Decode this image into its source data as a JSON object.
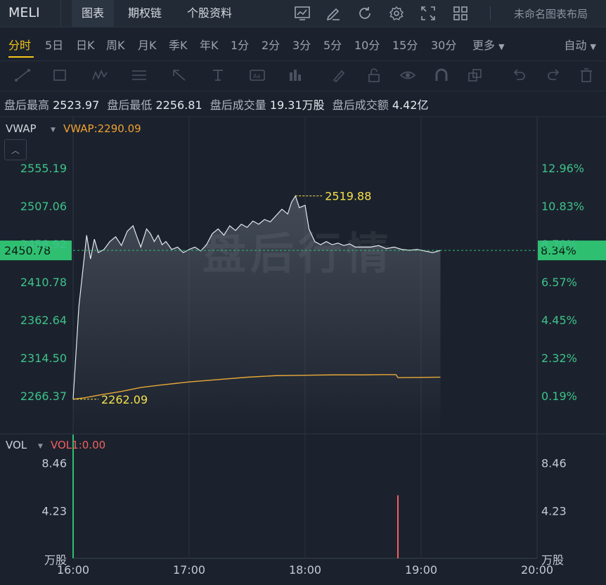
{
  "header": {
    "symbol": "MELI",
    "tabs": [
      "图表",
      "期权链",
      "个股资料"
    ],
    "layout_name": "未命名图表布局"
  },
  "periods": {
    "items": [
      "分时",
      "5日",
      "日K",
      "周K",
      "月K",
      "季K",
      "年K",
      "1分",
      "2分",
      "3分",
      "5分",
      "10分",
      "15分",
      "30分",
      "更多"
    ],
    "active": "分时",
    "auto": "自动"
  },
  "stats": {
    "high_label": "盘后最高",
    "high": "2523.97",
    "low_label": "盘后最低",
    "low": "2256.81",
    "volume_label": "盘后成交量",
    "volume": "19.31万股",
    "turnover_label": "盘后成交额",
    "turnover": "4.42亿"
  },
  "watermark": "盘后行情",
  "chart_data": {
    "type": "line",
    "price_panel": {
      "indicator_label": "VWAP",
      "indicator_value": "VWAP:2290.09",
      "y_ticks_left": [
        "2555.19",
        "2507.06",
        "2458.92",
        "2410.78",
        "2362.64",
        "2314.50",
        "2266.37"
      ],
      "y_ticks_right": [
        "12.96%",
        "10.83%",
        "8.70%",
        "6.57%",
        "4.45%",
        "2.32%",
        "0.19%"
      ],
      "ylim": [
        2266.37,
        2555.19
      ],
      "last_price": "2450.78",
      "last_change": "8.34%",
      "annotations": {
        "high": "2519.88",
        "low": "2262.09"
      },
      "x_ticks": [
        "16:00",
        "17:00",
        "18:00",
        "19:00",
        "20:00"
      ],
      "xlim_minutes": [
        0,
        240
      ],
      "series": [
        {
          "name": "",
          "color": "#e6e9ee",
          "points": [
            [
              0,
              2262.09
            ],
            [
              3,
              2380
            ],
            [
              7,
              2470
            ],
            [
              9,
              2440
            ],
            [
              11,
              2465
            ],
            [
              13,
              2448
            ],
            [
              16,
              2452
            ],
            [
              19,
              2462
            ],
            [
              22,
              2468
            ],
            [
              25,
              2457
            ],
            [
              28,
              2475
            ],
            [
              31,
              2482
            ],
            [
              33,
              2468
            ],
            [
              35,
              2455
            ],
            [
              38,
              2478
            ],
            [
              40,
              2472
            ],
            [
              42,
              2462
            ],
            [
              44,
              2470
            ],
            [
              46,
              2458
            ],
            [
              48,
              2462
            ],
            [
              51,
              2452
            ],
            [
              54,
              2455
            ],
            [
              57,
              2448
            ],
            [
              60,
              2452
            ],
            [
              63,
              2455
            ],
            [
              66,
              2450
            ],
            [
              69,
              2458
            ],
            [
              72,
              2472
            ],
            [
              75,
              2478
            ],
            [
              78,
              2470
            ],
            [
              81,
              2482
            ],
            [
              84,
              2476
            ],
            [
              87,
              2484
            ],
            [
              90,
              2480
            ],
            [
              93,
              2488
            ],
            [
              96,
              2484
            ],
            [
              99,
              2490
            ],
            [
              102,
              2487
            ],
            [
              105,
              2495
            ],
            [
              108,
              2503
            ],
            [
              111,
              2497
            ],
            [
              113,
              2512
            ],
            [
              115,
              2519.88
            ],
            [
              117,
              2505
            ],
            [
              120,
              2508
            ],
            [
              122,
              2478
            ],
            [
              125,
              2462
            ],
            [
              128,
              2458
            ],
            [
              131,
              2462
            ],
            [
              134,
              2458
            ],
            [
              137,
              2460
            ],
            [
              140,
              2457
            ],
            [
              143,
              2459
            ],
            [
              146,
              2455
            ],
            [
              150,
              2455
            ],
            [
              154,
              2455
            ],
            [
              158,
              2457
            ],
            [
              162,
              2453
            ],
            [
              166,
              2455
            ],
            [
              170,
              2452
            ],
            [
              174,
              2451
            ],
            [
              178,
              2452
            ],
            [
              182,
              2450
            ],
            [
              186,
              2448
            ],
            [
              190,
              2450.78
            ]
          ]
        },
        {
          "name": "VWAP",
          "color": "#e8a838",
          "points": [
            [
              0,
              2262.09
            ],
            [
              6,
              2264
            ],
            [
              15,
              2268
            ],
            [
              25,
              2272
            ],
            [
              35,
              2277
            ],
            [
              45,
              2280
            ],
            [
              60,
              2284
            ],
            [
              75,
              2287
            ],
            [
              90,
              2290
            ],
            [
              105,
              2292
            ],
            [
              120,
              2292.5
            ],
            [
              135,
              2293
            ],
            [
              150,
              2293
            ],
            [
              160,
              2293.3
            ],
            [
              167,
              2293.3
            ],
            [
              168,
              2289.5
            ],
            [
              190,
              2290.09
            ]
          ]
        }
      ]
    },
    "volume_panel": {
      "indicator_label": "VOL",
      "indicator_value": "VOL1:0.00",
      "y_ticks": [
        "8.46",
        "4.23"
      ],
      "unit": "万股",
      "ylim": [
        0,
        11.0
      ],
      "bars": [
        {
          "minute": 0,
          "value": 11.0,
          "color": "#2fbf71"
        },
        {
          "minute": 168,
          "value": 5.6,
          "color": "#f06060"
        }
      ]
    }
  }
}
